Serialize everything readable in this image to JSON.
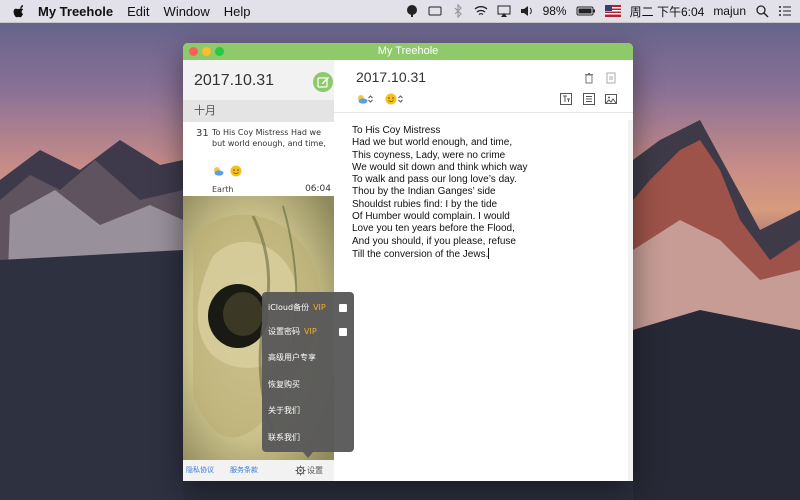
{
  "menubar": {
    "app_name": "My Treehole",
    "items": [
      "Edit",
      "Window",
      "Help"
    ],
    "battery": "98%",
    "datetime": "周二 下午6:04",
    "user": "majun"
  },
  "window": {
    "title": "My Treehole",
    "accent_color": "#8ec96a"
  },
  "sidebar": {
    "date": "2017.10.31",
    "month": "十月",
    "entry": {
      "day": "31",
      "text": "To His Coy Mistress Had we but world enough, and time,",
      "location": "Earth",
      "time": "06:04",
      "weather_icon": "partly-cloudy-icon",
      "mood_icon": "smiley-icon"
    },
    "footer": {
      "privacy": "隐私协议",
      "terms": "服务条款",
      "settings": "设置"
    }
  },
  "editor": {
    "date": "2017.10.31",
    "lines": [
      "To His Coy Mistress",
      "Had we but world enough, and time,",
      "This coyness, Lady, were no crime",
      "We would sit down and think which way",
      "To walk and pass our long love’s day.",
      "Thou by the Indian Ganges’ side",
      "Shouldst rubies find: I by the tide",
      "Of Humber would complain. I would",
      "Love you ten years before the Flood,",
      "And you should, if you please, refuse",
      "Till the conversion of the Jews."
    ]
  },
  "settings_menu": {
    "icloud_backup": "iCloud备份",
    "set_password": "设置密码",
    "vip": "VIP",
    "premium": "高级用户专享",
    "restore": "恢复购买",
    "about": "关于我们",
    "contact": "联系我们"
  }
}
